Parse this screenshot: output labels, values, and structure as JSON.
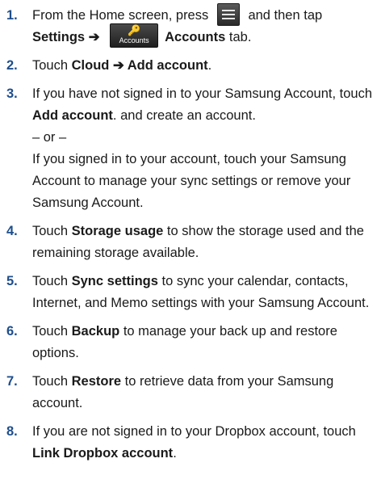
{
  "steps": [
    {
      "number": "1.",
      "line1_pre": "From the Home screen, press",
      "line1_post": "and then tap",
      "settings": "Settings",
      "arrow": "➔",
      "accounts_icon_label": "Accounts",
      "accounts_tab_bold": "Accounts",
      "accounts_tab_rest": " tab.",
      "menu_icon": "menu-key-icon"
    },
    {
      "number": "2.",
      "pre": "Touch ",
      "bold": "Cloud ➔ Add account",
      "post": "."
    },
    {
      "number": "3.",
      "pre": "If you have not signed in to your Samsung Account, touch ",
      "bold": "Add account",
      "post": ". and create an account.",
      "or": "– or –",
      "alt": "If you signed in to your account, touch your Samsung Account to manage your sync settings or remove your Samsung Account."
    },
    {
      "number": "4.",
      "pre": "Touch ",
      "bold": "Storage usage",
      "post": " to show the storage used and the remaining storage available."
    },
    {
      "number": "5.",
      "pre": "Touch ",
      "bold": "Sync settings",
      "post": " to sync your calendar, contacts, Internet, and Memo settings with your Samsung Account."
    },
    {
      "number": "6.",
      "pre": "Touch ",
      "bold": "Backup",
      "post": " to manage your back up and restore options."
    },
    {
      "number": "7.",
      "pre": "Touch ",
      "bold": "Restore",
      "post": " to retrieve data from your Samsung account."
    },
    {
      "number": "8.",
      "pre": "If you are not signed in to your Dropbox account, touch ",
      "bold": "Link Dropbox account",
      "post": "."
    }
  ]
}
